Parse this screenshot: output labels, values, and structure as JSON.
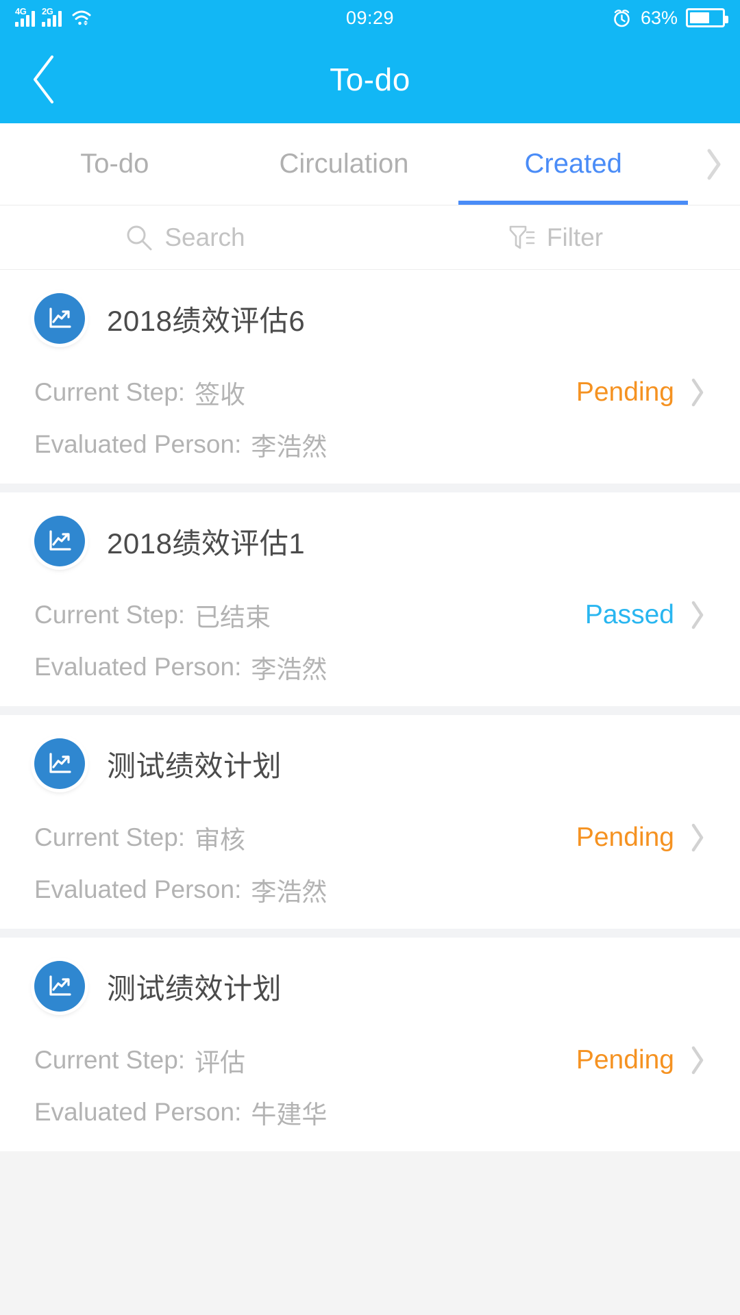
{
  "status_bar": {
    "signal_1_label": "4G",
    "signal_2_label": "2G",
    "wifi_icon": "wifi-icon",
    "time": "09:29",
    "alarm_icon": "alarm-clock-icon",
    "battery_percent": "63%",
    "battery_level": 63
  },
  "nav": {
    "back_icon": "back-chevron-icon",
    "title": "To-do"
  },
  "tabs": {
    "items": [
      {
        "label": "To-do",
        "active": false
      },
      {
        "label": "Circulation",
        "active": false
      },
      {
        "label": "Created",
        "active": true
      }
    ],
    "more_icon": "chevron-right-icon"
  },
  "toolbar": {
    "search_icon": "search-icon",
    "search_label": "Search",
    "filter_icon": "filter-icon",
    "filter_label": "Filter"
  },
  "labels": {
    "current_step": "Current Step:",
    "evaluated_person": "Evaluated Person:"
  },
  "colors": {
    "brand_blue": "#12b7f5",
    "tab_active": "#4a8cf7",
    "status_pending": "#f59221",
    "status_passed": "#29b6f0",
    "icon_blue": "#2f87d0",
    "text_primary": "#4b4b4b",
    "text_secondary": "#b3b3b3"
  },
  "list": {
    "items": [
      {
        "icon": "performance-chart-icon",
        "title": "2018绩效评估6",
        "current_step": "签收",
        "evaluated_person": "李浩然",
        "status": "Pending",
        "status_color": "#f59221",
        "chevron_icon": "chevron-right-icon"
      },
      {
        "icon": "performance-chart-icon",
        "title": "2018绩效评估1",
        "current_step": "已结束",
        "evaluated_person": "李浩然",
        "status": "Passed",
        "status_color": "#29b6f0",
        "chevron_icon": "chevron-right-icon"
      },
      {
        "icon": "performance-chart-icon",
        "title": "测试绩效计划",
        "current_step": "审核",
        "evaluated_person": "李浩然",
        "status": "Pending",
        "status_color": "#f59221",
        "chevron_icon": "chevron-right-icon"
      },
      {
        "icon": "performance-chart-icon",
        "title": "测试绩效计划",
        "current_step": "评估",
        "evaluated_person": "牛建华",
        "status": "Pending",
        "status_color": "#f59221",
        "chevron_icon": "chevron-right-icon"
      }
    ]
  }
}
